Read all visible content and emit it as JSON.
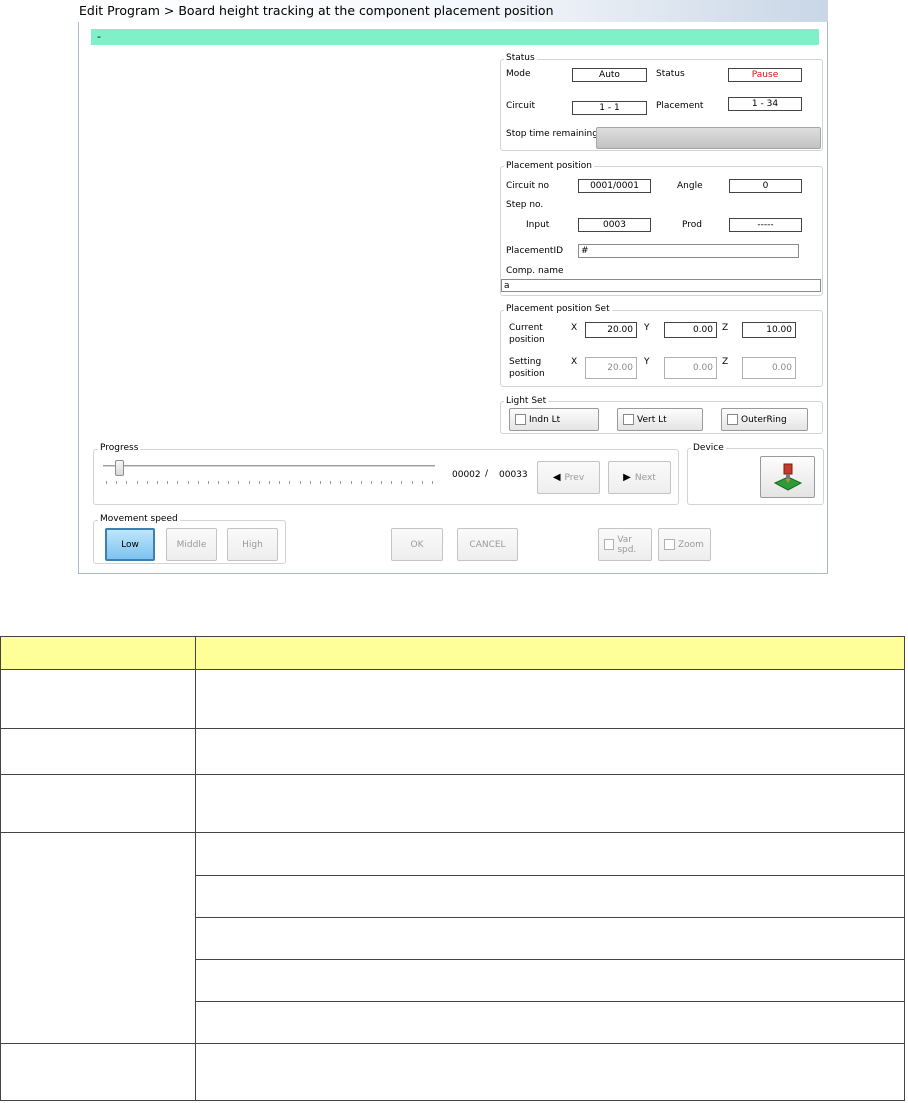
{
  "window": {
    "title": "Edit Program > Board height tracking at the component placement position",
    "banner_text": "-"
  },
  "status": {
    "group_label": "Status",
    "mode_label": "Mode",
    "mode_value": "Auto",
    "status_label": "Status",
    "status_value": "Pause",
    "status_color": "#e01010",
    "circuit_label": "Circuit",
    "circuit_value": "1 - 1",
    "placement_label": "Placement",
    "placement_value": "1 - 34",
    "stop_time_label": "Stop time remaining"
  },
  "placement_position": {
    "group_label": "Placement position",
    "circuit_no_label": "Circuit no",
    "circuit_no_value": "0001/0001",
    "angle_label": "Angle",
    "angle_value": "0",
    "step_no_label": "Step no.",
    "input_label": "Input",
    "input_value": "0003",
    "prod_label": "Prod",
    "prod_value": "-----",
    "placement_id_label": "PlacementID",
    "placement_id_value": "#",
    "comp_name_label": "Comp. name",
    "comp_name_value": "a"
  },
  "placement_set": {
    "group_label": "Placement position Set",
    "current_label_1": "Current",
    "current_label_2": "position",
    "setting_label_1": "Setting",
    "setting_label_2": "position",
    "x_label": "X",
    "y_label": "Y",
    "z_label": "Z",
    "current_x": "20.00",
    "current_y": "0.00",
    "current_z": "10.00",
    "setting_x": "20.00",
    "setting_y": "0.00",
    "setting_z": "0.00"
  },
  "light_set": {
    "group_label": "Light Set",
    "indn_lt": "Indn Lt",
    "vert_lt": "Vert Lt",
    "outer_ring": "OuterRing"
  },
  "progress": {
    "group_label": "Progress",
    "current": "00002",
    "separator": "/",
    "total": "00033",
    "slider_fraction": 0.0303,
    "prev_label": "Prev",
    "next_label": "Next"
  },
  "device": {
    "group_label": "Device",
    "icon": "nozzle-device-icon"
  },
  "movement_speed": {
    "group_label": "Movement speed",
    "low": "Low",
    "middle": "Middle",
    "high": "High"
  },
  "actions": {
    "ok": "OK",
    "cancel": "CANCEL",
    "var_spd": "Var spd.",
    "zoom": "Zoom"
  },
  "colors": {
    "banner": "#80f0c8",
    "table_header": "#ffff99",
    "selected_button": "#7cc3ee"
  }
}
